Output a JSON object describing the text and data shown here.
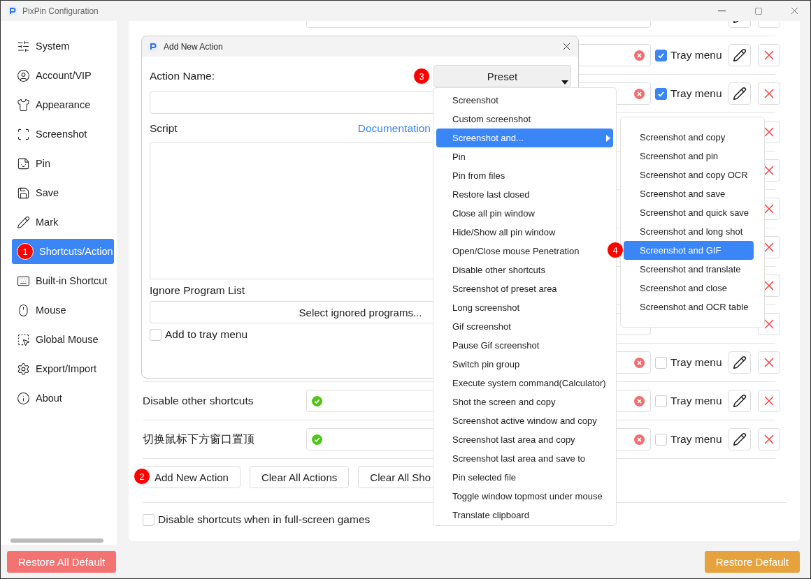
{
  "window": {
    "title": "PixPin Configuration"
  },
  "sidebar": {
    "items": [
      {
        "label": "System",
        "selected": false
      },
      {
        "label": "Account/VIP",
        "selected": false
      },
      {
        "label": "Appearance",
        "selected": false
      },
      {
        "label": "Screenshot",
        "selected": false
      },
      {
        "label": "Pin",
        "selected": false
      },
      {
        "label": "Save",
        "selected": false
      },
      {
        "label": "Mark",
        "selected": false
      },
      {
        "label": "Shortcuts/Action",
        "selected": true,
        "badge": "1"
      },
      {
        "label": "Built-in Shortcut",
        "selected": false
      },
      {
        "label": "Mouse",
        "selected": false
      },
      {
        "label": "Global Mouse",
        "selected": false
      },
      {
        "label": "Export/Import",
        "selected": false
      },
      {
        "label": "About",
        "selected": false
      }
    ],
    "restore_button": "Restore All Default"
  },
  "shortcut_rows": [
    {
      "kind": "top_cut"
    },
    {
      "kind": "full",
      "field": {
        "clearable": true
      },
      "tray": {
        "checked": true,
        "label": "Tray menu"
      }
    },
    {
      "kind": "full",
      "field": {
        "clearable": true
      },
      "tray": {
        "checked": true,
        "label": "Tray menu"
      }
    },
    {
      "kind": "delete_only"
    },
    {
      "kind": "delete_only"
    },
    {
      "kind": "delete_only"
    },
    {
      "kind": "delete_only"
    },
    {
      "kind": "delete_only"
    },
    {
      "kind": "field_and_delete"
    },
    {
      "kind": "full",
      "field": {
        "clearable": true
      },
      "tray": {
        "checked": false,
        "label": "Tray menu"
      }
    },
    {
      "kind": "full",
      "label": "Disable other shortcuts",
      "field": {
        "valid": true,
        "clearable": true
      },
      "tray": {
        "checked": false,
        "label": "Tray menu"
      }
    },
    {
      "kind": "full",
      "label": "切换鼠标下方窗口置顶",
      "field": {
        "valid": true,
        "clearable": true
      },
      "tray": {
        "checked": false,
        "label": "Tray menu"
      }
    }
  ],
  "actions": [
    {
      "label": "Add New Action",
      "badge": "2"
    },
    {
      "label": "Clear All Actions"
    },
    {
      "label": "Clear All Sho"
    }
  ],
  "fullscreen_option": {
    "label": "Disable shortcuts when in full-screen games",
    "checked": false
  },
  "restore_default": "Restore Default",
  "dialog": {
    "title": "Add New Action",
    "name_label": "Action Name:",
    "preset": {
      "label": "Preset",
      "badge": "3"
    },
    "script_label": "Script",
    "doc_link": "Documentation",
    "ignore_label": "Ignore Program List",
    "ignore_button": "Select ignored programs...",
    "tray_checkbox": {
      "label": "Add to tray menu",
      "checked": false
    }
  },
  "preset_menu": {
    "items": [
      {
        "label": "Screenshot",
        "selected": false,
        "has_submenu": false
      },
      {
        "label": "Custom screenshot",
        "selected": false,
        "has_submenu": false
      },
      {
        "label": "Screenshot and...",
        "selected": true,
        "has_submenu": true
      },
      {
        "label": "Pin",
        "selected": false,
        "has_submenu": false
      },
      {
        "label": "Pin from files",
        "selected": false,
        "has_submenu": false
      },
      {
        "label": "Restore last closed",
        "selected": false,
        "has_submenu": false
      },
      {
        "label": "Close all pin window",
        "selected": false,
        "has_submenu": false
      },
      {
        "label": "Hide/Show all pin window",
        "selected": false,
        "has_submenu": false
      },
      {
        "label": "Open/Close mouse Penetration",
        "selected": false,
        "has_submenu": false
      },
      {
        "label": "Disable other shortcuts",
        "selected": false,
        "has_submenu": false
      },
      {
        "label": "Screenshot of preset area",
        "selected": false,
        "has_submenu": false
      },
      {
        "label": "Long screenshot",
        "selected": false,
        "has_submenu": false
      },
      {
        "label": "Gif screenshot",
        "selected": false,
        "has_submenu": false
      },
      {
        "label": "Pause Gif screenshot",
        "selected": false,
        "has_submenu": false
      },
      {
        "label": "Switch pin group",
        "selected": false,
        "has_submenu": false
      },
      {
        "label": "Execute system command(Calculator)",
        "selected": false,
        "has_submenu": false
      },
      {
        "label": "Shot the screen and copy",
        "selected": false,
        "has_submenu": false
      },
      {
        "label": "Screenshot active window and copy",
        "selected": false,
        "has_submenu": false
      },
      {
        "label": "Screenshot last area and copy",
        "selected": false,
        "has_submenu": false
      },
      {
        "label": "Screenshot last area and save to",
        "selected": false,
        "has_submenu": false
      },
      {
        "label": "Pin selected file",
        "selected": false,
        "has_submenu": false
      },
      {
        "label": "Toggle window topmost under mouse",
        "selected": false,
        "has_submenu": false
      },
      {
        "label": "Translate clipboard",
        "selected": false,
        "has_submenu": false
      }
    ]
  },
  "submenu": {
    "items": [
      {
        "label": "Screenshot and copy",
        "selected": false
      },
      {
        "label": "Screenshot and pin",
        "selected": false
      },
      {
        "label": "Screenshot and copy OCR",
        "selected": false
      },
      {
        "label": "Screenshot and save",
        "selected": false
      },
      {
        "label": "Screenshot and quick save",
        "selected": false
      },
      {
        "label": "Screenshot and long shot",
        "selected": false
      },
      {
        "label": "Screenshot and GIF",
        "selected": true,
        "badge": "4"
      },
      {
        "label": "Screenshot and translate",
        "selected": false
      },
      {
        "label": "Screenshot and close",
        "selected": false
      },
      {
        "label": "Screenshot and OCR table",
        "selected": false
      }
    ]
  }
}
